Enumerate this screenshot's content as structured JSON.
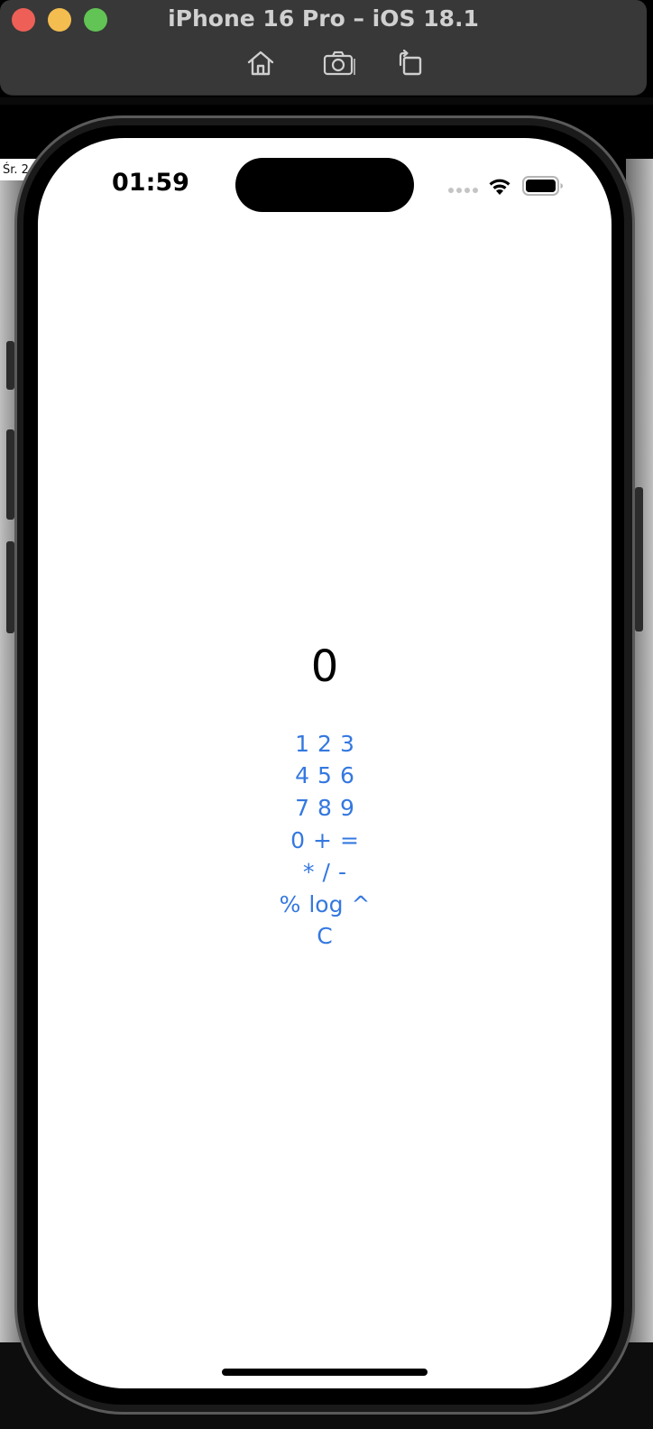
{
  "window": {
    "title": "iPhone 16 Pro – iOS 18.1",
    "toolbar": {
      "home_icon": "home-icon",
      "screenshot_icon": "camera-icon",
      "rotate_icon": "rotate-icon"
    }
  },
  "background": {
    "side_date": "Śr. 2"
  },
  "status_bar": {
    "time": "01:59",
    "wifi_icon": "wifi-icon",
    "battery_icon": "battery-icon"
  },
  "calculator": {
    "display": "0",
    "rows": [
      [
        "1",
        "2",
        "3"
      ],
      [
        "4",
        "5",
        "6"
      ],
      [
        "7",
        "8",
        "9"
      ],
      [
        "0",
        "+",
        "="
      ],
      [
        "*",
        "/",
        "-"
      ],
      [
        "%",
        "log",
        "^"
      ],
      [
        "C"
      ]
    ]
  },
  "colors": {
    "accent": "#3478e0",
    "titlebar": "#383838",
    "traffic_red": "#ee5f57",
    "traffic_yellow": "#f4bd4f",
    "traffic_green": "#61c454"
  }
}
